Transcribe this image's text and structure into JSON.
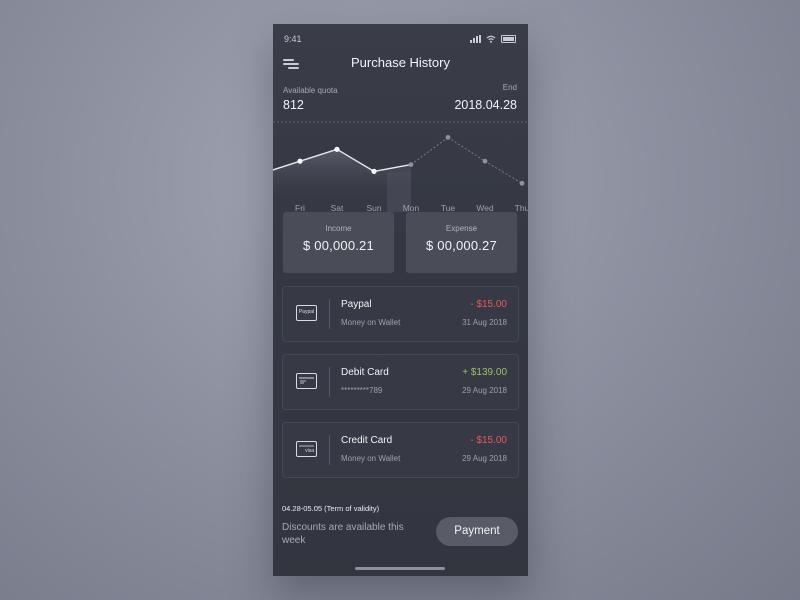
{
  "status_bar": {
    "time": "9:41"
  },
  "header": {
    "title": "Purchase History"
  },
  "quota": {
    "label": "Available quota",
    "value": "812"
  },
  "end": {
    "label": "End",
    "value": "2018.04.28"
  },
  "chart_data": {
    "type": "line",
    "categories": [
      "Fri",
      "Sat",
      "Sun",
      "Mon",
      "Tue",
      "Wed",
      "Thu"
    ],
    "values": [
      48,
      62,
      36,
      44,
      76,
      48,
      22
    ],
    "selected_category": "Mon",
    "ylim": [
      0,
      100
    ],
    "grid": false
  },
  "income": {
    "label": "Income",
    "value": "$ 00,000.21"
  },
  "expense": {
    "label": "Expense",
    "value": "$ 00,000.27"
  },
  "transactions": [
    {
      "icon": "paypal-card-icon",
      "icon_text": "Paypal",
      "name": "Paypal",
      "subtitle": "Money on Wallet",
      "amount": "- $15.00",
      "date": "31 Aug 2018"
    },
    {
      "icon": "debit-card-icon",
      "icon_text": "",
      "name": "Debit Card",
      "subtitle": "*********789",
      "amount": "+ $139.00",
      "date": "29 Aug 2018"
    },
    {
      "icon": "visa-card-icon",
      "icon_text": "visa",
      "name": "Credit Card",
      "subtitle": "Money on Wallet",
      "amount": "- $15.00",
      "date": "29 Aug 2018"
    }
  ],
  "footer": {
    "term": "04.28-05.05 (Term of validity)",
    "discount": "Discounts are available this week",
    "payment_label": "Payment"
  },
  "colors": {
    "negative": "#e25c5c",
    "positive": "#9dbf6b",
    "background": "#353843"
  }
}
